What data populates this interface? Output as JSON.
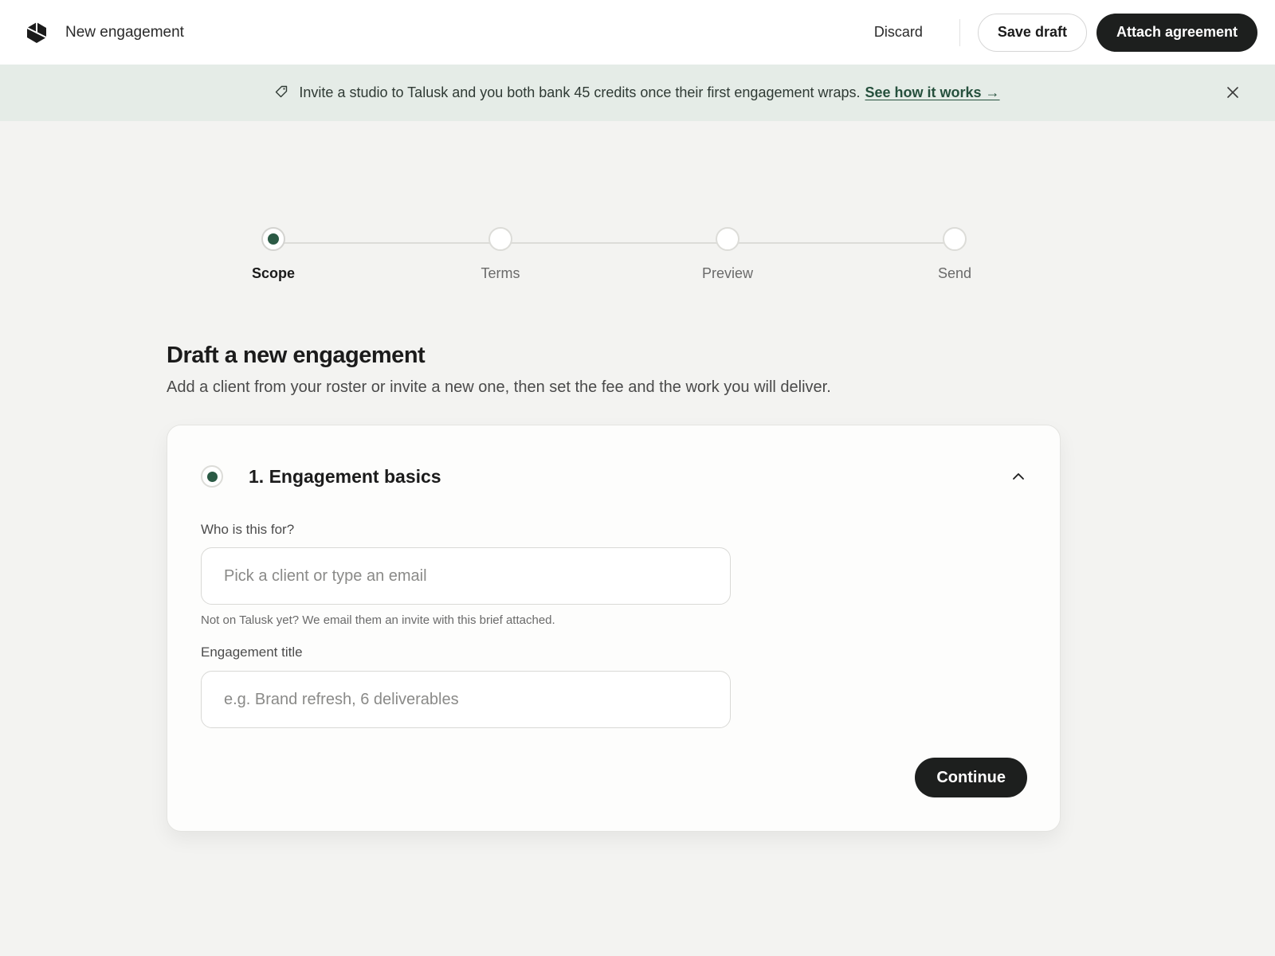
{
  "header": {
    "title": "New engagement",
    "discard_label": "Discard",
    "save_draft_label": "Save draft",
    "attach_label": "Attach agreement"
  },
  "banner": {
    "message": "Invite a studio to Talusk and you both bank 45 credits once their first engagement wraps.",
    "link_label": "See how it works →",
    "icon": "tag-icon"
  },
  "stepper": {
    "steps": [
      {
        "label": "Scope",
        "state": "active"
      },
      {
        "label": "Terms",
        "state": "upcoming"
      },
      {
        "label": "Preview",
        "state": "upcoming"
      },
      {
        "label": "Send",
        "state": "upcoming"
      }
    ]
  },
  "main": {
    "title": "Draft a new engagement",
    "subtitle": "Add a client from your roster or invite a new one, then set the fee and the work you will deliver."
  },
  "card": {
    "title": "1. Engagement basics",
    "client_field": {
      "label": "Who is this for?",
      "placeholder": "Pick a client or type an email",
      "value": "",
      "help": "Not on Talusk yet? We email them an invite with this brief attached."
    },
    "title_field": {
      "label": "Engagement title",
      "placeholder": "e.g. Brand refresh, 6 deliverables",
      "value": ""
    },
    "continue_label": "Continue"
  },
  "colors": {
    "accent": "#2b5a45",
    "primary_button": "#1d1f1e",
    "banner_bg": "#e5ece7",
    "page_bg": "#f3f3f1"
  }
}
